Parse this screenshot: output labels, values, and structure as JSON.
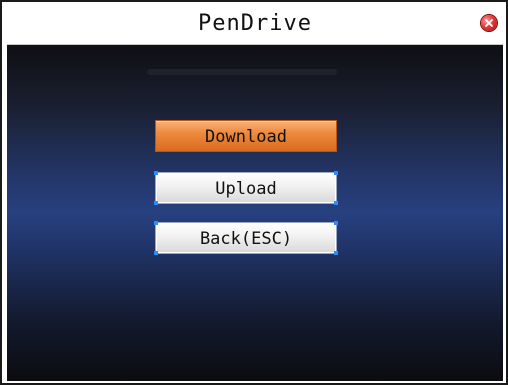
{
  "window": {
    "title": "PenDrive"
  },
  "menu": {
    "items": [
      {
        "label": "Download",
        "selected": true
      },
      {
        "label": "Upload",
        "selected": false
      },
      {
        "label": "Back(ESC)",
        "selected": false
      }
    ]
  },
  "colors": {
    "selected_button": "#ee8a3f",
    "normal_button": "#f1f1f1",
    "screen_background": "#274080",
    "close_icon": "#e33b3b"
  },
  "icons": {
    "close": "close-icon"
  }
}
